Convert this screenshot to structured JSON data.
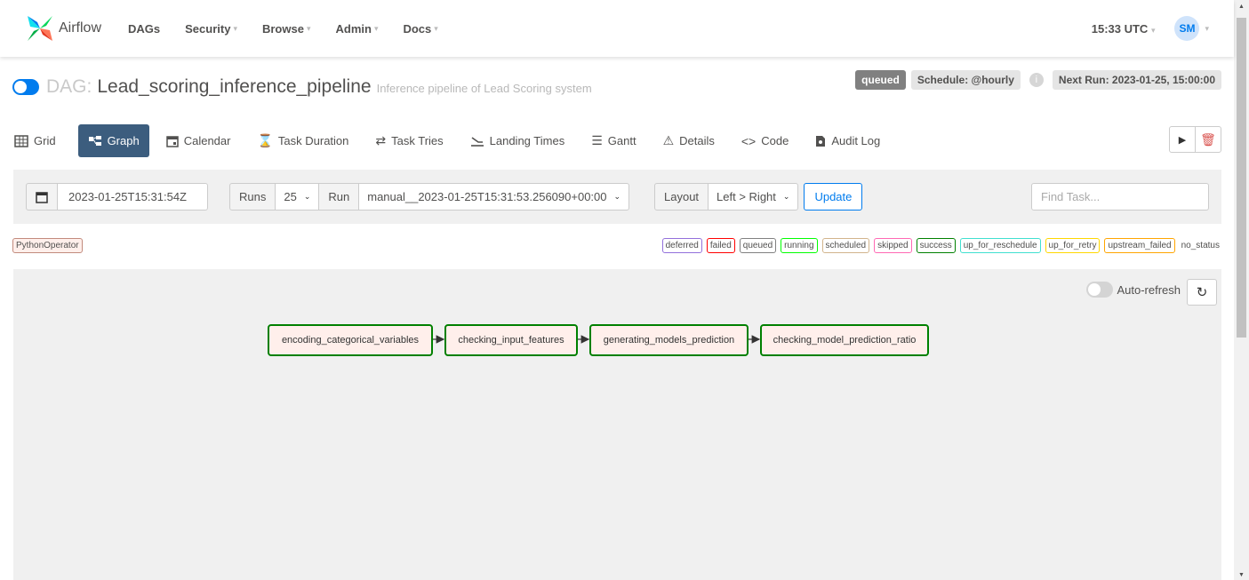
{
  "navbar": {
    "brand": "Airflow",
    "items": [
      "DAGs",
      "Security",
      "Browse",
      "Admin",
      "Docs"
    ],
    "time": "15:33 UTC",
    "user_initials": "SM"
  },
  "dag": {
    "prefix": "DAG:",
    "id": "Lead_scoring_inference_pipeline",
    "description": "Inference pipeline of Lead Scoring system",
    "state_badge": "queued",
    "schedule": "Schedule: @hourly",
    "next_run": "Next Run: 2023-01-25, 15:00:00"
  },
  "tabs": [
    {
      "label": "Grid",
      "icon": "grid-icon"
    },
    {
      "label": "Graph",
      "icon": "graph-icon"
    },
    {
      "label": "Calendar",
      "icon": "calendar-icon"
    },
    {
      "label": "Task Duration",
      "icon": "hourglass-icon"
    },
    {
      "label": "Task Tries",
      "icon": "repeat-icon"
    },
    {
      "label": "Landing Times",
      "icon": "landing-icon"
    },
    {
      "label": "Gantt",
      "icon": "gantt-icon"
    },
    {
      "label": "Details",
      "icon": "warning-triangle-icon"
    },
    {
      "label": "Code",
      "icon": "code-icon"
    },
    {
      "label": "Audit Log",
      "icon": "file-icon"
    }
  ],
  "filters": {
    "base_date": "2023-01-25T15:31:54Z",
    "runs_label": "Runs",
    "runs_value": "25",
    "run_label": "Run",
    "run_value": "manual__2023-01-25T15:31:53.256090+00:00",
    "layout_label": "Layout",
    "layout_value": "Left > Right",
    "update_label": "Update",
    "find_placeholder": "Find Task..."
  },
  "operator_badge": "PythonOperator",
  "legend": [
    {
      "label": "deferred",
      "color": "#9370db"
    },
    {
      "label": "failed",
      "color": "#ff0000"
    },
    {
      "label": "queued",
      "color": "#808080"
    },
    {
      "label": "running",
      "color": "#00ff00"
    },
    {
      "label": "scheduled",
      "color": "#d2b48c"
    },
    {
      "label": "skipped",
      "color": "#ff69b4"
    },
    {
      "label": "success",
      "color": "#008000"
    },
    {
      "label": "up_for_reschedule",
      "color": "#40e0d0"
    },
    {
      "label": "up_for_retry",
      "color": "#ffd700"
    },
    {
      "label": "upstream_failed",
      "color": "#ffa500"
    },
    {
      "label": "no_status",
      "color": ""
    }
  ],
  "graph": {
    "autorefresh_label": "Auto-refresh",
    "nodes": [
      "encoding_categorical_variables",
      "checking_input_features",
      "generating_models_prediction",
      "checking_model_prediction_ratio"
    ]
  }
}
